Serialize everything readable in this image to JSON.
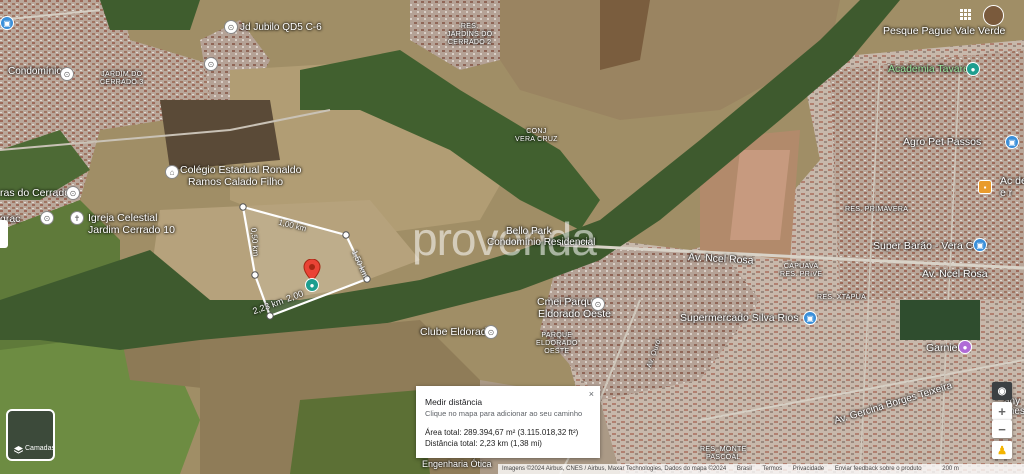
{
  "watermark": "provenda",
  "measure_panel": {
    "title": "Medir distância",
    "subtitle": "Clique no mapa para adicionar ao seu caminho",
    "area": "Área total: 289.394,67 m² (3.115.018,32 ft²)",
    "distance": "Distância total: 2,23 km (1,38 mi)",
    "close": "×"
  },
  "segments": {
    "top": "1,00 km",
    "left": "0,50 km",
    "right": "1,50 km",
    "bottom_a": "2,23 km",
    "bottom_b": "2,00"
  },
  "places": {
    "jubilo": "Jd Jubilo QD5 C-6",
    "res_jardins": "RES.\nJARDINS DO\nCERRADO 2",
    "condominio": "Condomínio",
    "jardim_do_cerrado": "JARDIM DO\nCERRADO 3",
    "colegio_1": "Colégio Estadual Ronaldo",
    "colegio_2": "Ramos Calado Filho",
    "ras_do_cerrado": "ras do Cerrado",
    "igreja_1": "Igreja Celestial",
    "igreja_2": "Jardim Cerrado 10",
    "grac": "grac",
    "conj_vera_cruz": "CONJ\nVERA CRUZ",
    "pesque": "Pesque Pague Vale Verde",
    "academia": "Academia Tavares",
    "agro": "Agro Pet Passos",
    "res_primavera": "RES. PRIMAVERA",
    "super_barao": "Super Barão - Vera Cruz",
    "av_ncel_rosa_1": "Av. Ncel Rosa",
    "av_ncel_rosa_2": "Av. Ncel Rosa",
    "res_prive": "CAPUAVA\nRES. PRIVE",
    "res_xtapua": "RES. XTAPUA",
    "bello_1": "Bello Park",
    "bello_2": "Condomínio Residencial",
    "cmei_1": "Cmei Parque",
    "cmei_2": "Eldorado Oeste",
    "parque_eldorado": "PARQUE\nELDORADO\nOESTE",
    "clube": "Clube Eldorado",
    "supermercado": "Supermercado Silva Rios",
    "garnier": "Garnier",
    "av_gercina": "Av. Gercina Borges Teixeira",
    "av_ouro": "Av. Ouro",
    "engenharia": "Engenharia Ótica",
    "res_monte": "RES. MONTE\nPASCOAL",
    "any": "any",
    "mesa": "mesa",
    "ac": "Ac de\ne r"
  },
  "layers_button": {
    "label": "Camadas"
  },
  "attribution": {
    "imagery": "Imagens ©2024 Airbus, CNES / Airbus, Maxar Technologies, Dados do mapa ©2024",
    "brasil": "Brasil",
    "termos": "Termos",
    "privacidade": "Privacidade",
    "feedback": "Enviar feedback sobre o produto",
    "scale": "200 m"
  },
  "colors": {
    "measure_line": "#ffffff",
    "pin_red": "#ea4335",
    "pin_teal": "#1e9e8f",
    "pin_blue": "#3a8fd9"
  }
}
